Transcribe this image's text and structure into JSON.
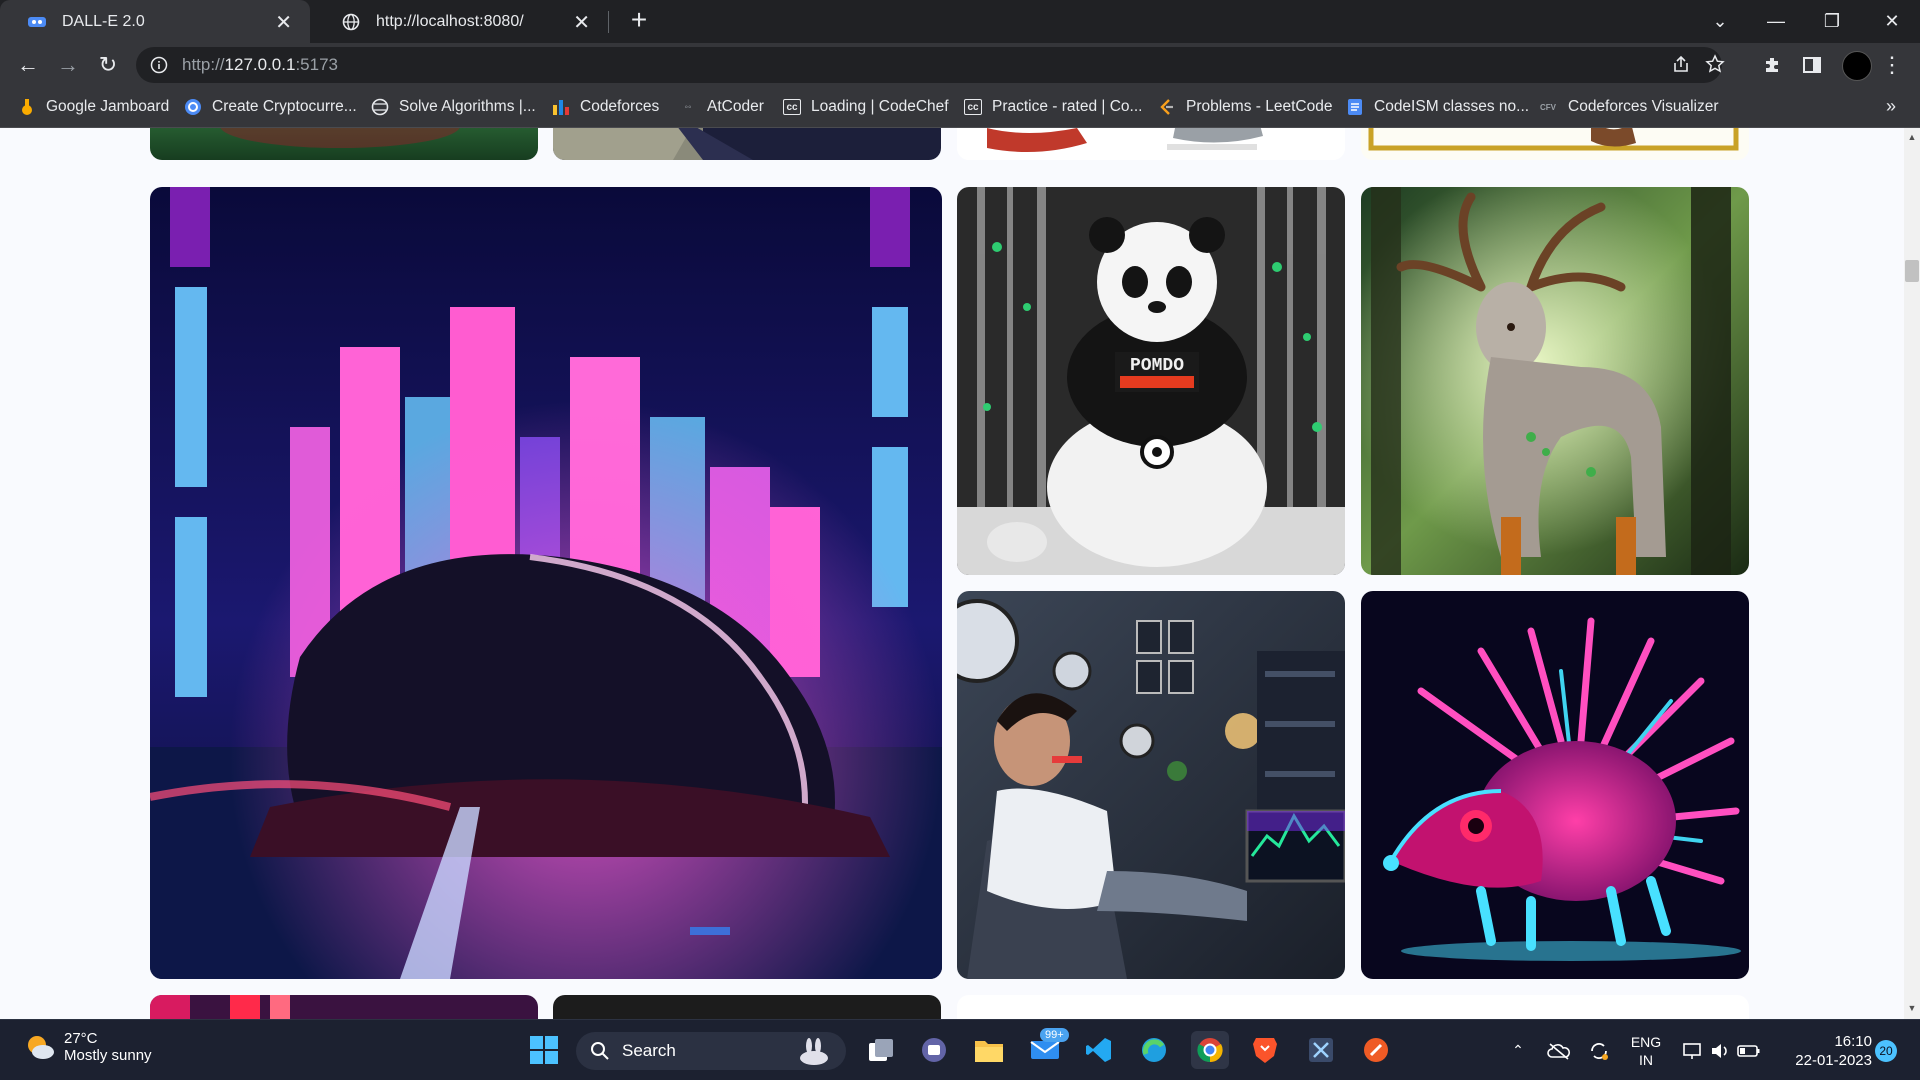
{
  "browser": {
    "tabs": [
      {
        "title": "DALL-E 2.0",
        "active": true
      },
      {
        "title": "http://localhost:8080/",
        "active": false
      }
    ],
    "address": {
      "scheme": "http://",
      "host": "127.0.0.1",
      "port": ":5173"
    },
    "bookmarks": [
      {
        "label": "Google Jamboard",
        "icon": "jamboard-icon"
      },
      {
        "label": "Create Cryptocurre...",
        "icon": "crypto-icon"
      },
      {
        "label": "Solve Algorithms |...",
        "icon": "globe-icon"
      },
      {
        "label": "Codeforces",
        "icon": "codeforces-icon"
      },
      {
        "label": "AtCoder",
        "icon": "atcoder-icon"
      },
      {
        "label": "Loading | CodeChef",
        "icon": "codechef-icon"
      },
      {
        "label": "Practice - rated | Co...",
        "icon": "codechef-icon"
      },
      {
        "label": "Problems - LeetCode",
        "icon": "leetcode-icon"
      },
      {
        "label": "CodeISM classes no...",
        "icon": "docs-icon"
      },
      {
        "label": "Codeforces Visualizer",
        "icon": "cfv-icon"
      }
    ],
    "more_bookmarks": "»"
  },
  "gallery": {
    "images": [
      {
        "id": "green-partial",
        "alt": "generated image"
      },
      {
        "id": "texture-partial",
        "alt": "generated image"
      },
      {
        "id": "shoes-partial",
        "alt": "generated image"
      },
      {
        "id": "frame-partial",
        "alt": "generated image"
      },
      {
        "id": "cyberpunk-city",
        "alt": "generated image"
      },
      {
        "id": "panda",
        "alt": "generated image",
        "shirt_text": "POMDO"
      },
      {
        "id": "deer",
        "alt": "generated image"
      },
      {
        "id": "man-room",
        "alt": "generated image"
      },
      {
        "id": "hedgehog",
        "alt": "generated image"
      }
    ]
  },
  "taskbar": {
    "weather": {
      "temp": "27°C",
      "condition": "Mostly sunny"
    },
    "search_label": "Search",
    "mail_badge": "99+",
    "lang": {
      "line1": "ENG",
      "line2": "IN"
    },
    "time": "16:10",
    "date": "22-01-2023",
    "notifications": "20"
  },
  "colors": {
    "chrome_dark": "#202124",
    "chrome_mid": "#35363a",
    "page_bg": "#f9fafe",
    "taskbar": "#1c2130"
  }
}
